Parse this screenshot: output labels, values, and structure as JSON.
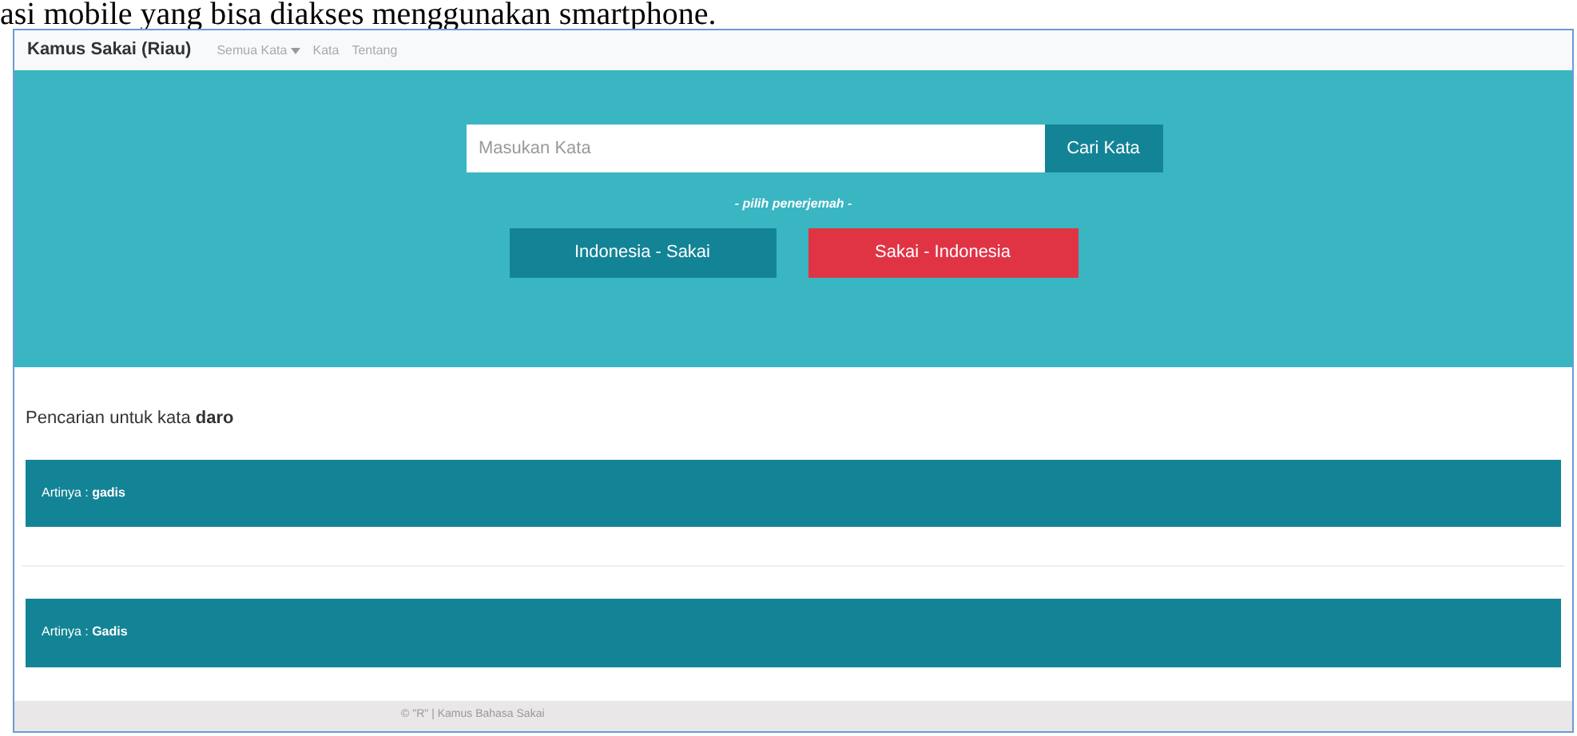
{
  "document_text": "asi mobile yang bisa diakses menggunakan smartphone.",
  "navbar": {
    "brand": "Kamus Sakai (Riau)",
    "items": [
      {
        "label": "Semua Kata",
        "kind": "dropdown"
      },
      {
        "label": "Kata",
        "kind": "link"
      },
      {
        "label": "Tentang",
        "kind": "link"
      }
    ]
  },
  "search": {
    "placeholder": "Masukan Kata",
    "button": "Cari Kata"
  },
  "translator_label": "- pilih penerjemah -",
  "translators": [
    {
      "label": "Indonesia - Sakai",
      "selected": false
    },
    {
      "label": "Sakai - Indonesia",
      "selected": true
    }
  ],
  "result_heading": "Pencarian untuk kata **daro**",
  "results": [
    "Artinya : **gadis**",
    "Artinya : **Gadis**"
  ],
  "footer": "© \"R\" | Kamus Bahasa Sakai"
}
